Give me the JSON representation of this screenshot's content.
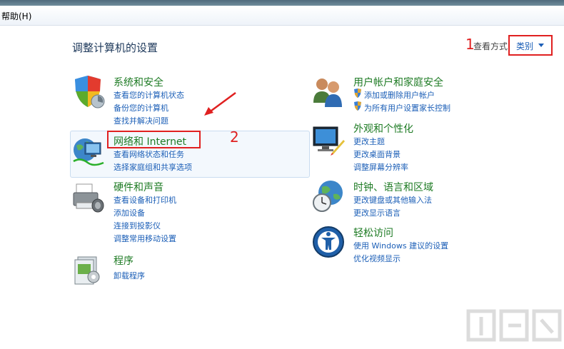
{
  "menu": {
    "help": "帮助(H)"
  },
  "page_title": "调整计算机的设置",
  "view": {
    "label": "查看方式:",
    "value": "类别"
  },
  "annotations": {
    "one": "1",
    "two": "2"
  },
  "categories": {
    "system": {
      "title": "系统和安全",
      "links": [
        "查看您的计算机状态",
        "备份您的计算机",
        "查找并解决问题"
      ]
    },
    "network": {
      "title": "网络和 Internet",
      "links": [
        "查看网络状态和任务",
        "选择家庭组和共享选项"
      ]
    },
    "hardware": {
      "title": "硬件和声音",
      "links": [
        "查看设备和打印机",
        "添加设备",
        "连接到投影仪",
        "调整常用移动设置"
      ]
    },
    "programs": {
      "title": "程序",
      "links": [
        "卸载程序"
      ]
    },
    "users": {
      "title": "用户帐户和家庭安全",
      "links": [
        "添加或删除用户帐户",
        "为所有用户设置家长控制"
      ]
    },
    "appearance": {
      "title": "外观和个性化",
      "links": [
        "更改主题",
        "更改桌面背景",
        "调整屏幕分辨率"
      ]
    },
    "clock": {
      "title": "时钟、语言和区域",
      "links": [
        "更改键盘或其他输入法",
        "更改显示语言"
      ]
    },
    "ease": {
      "title": "轻松访问",
      "links": [
        "使用 Windows 建议的设置",
        "优化视频显示"
      ]
    }
  },
  "watermark": "下载吧",
  "colors": {
    "title_green": "#1e7b24",
    "link_blue": "#1c5fb7",
    "annotation_red": "#e02020"
  }
}
